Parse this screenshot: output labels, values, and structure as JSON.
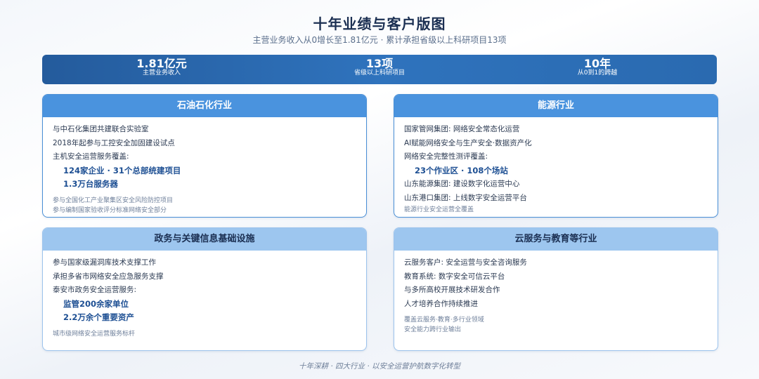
{
  "header": {
    "title": "十年业绩与客户版图",
    "subtitle": "主营业务收入从0增长至1.81亿元 · 累计承担省级以上科研项目13项"
  },
  "kpis": [
    {
      "value": "1.81亿元",
      "label": "主营业务收入"
    },
    {
      "value": "13项",
      "label": "省级以上科研项目"
    },
    {
      "value": "10年",
      "label": "从0到1的跨越"
    }
  ],
  "cards": {
    "petro": {
      "title": "石油石化行业",
      "lines": [
        "与中石化集团共建联合实验室",
        "2018年起参与工控安全加固建设试点",
        "主机安全运营服务覆盖:"
      ],
      "highlights": [
        "124家企业 · 31个总部统建项目",
        "1.3万台服务器"
      ],
      "notes": [
        "参与全国化工产业聚集区安全风险防控项目",
        "参与编制国家验收评分标准网络安全部分"
      ]
    },
    "energy": {
      "title": "能源行业",
      "lines": [
        "国家管网集团: 网络安全常态化运营",
        "AI赋能网络安全与生产安全·数据资产化",
        "网络安全完整性测评覆盖:"
      ],
      "highlights": [
        "23个作业区 · 108个场站"
      ],
      "lines2": [
        "山东能源集团: 建设数字化运营中心",
        "山东港口集团: 上线数字安全运营平台"
      ],
      "notes": [
        "能源行业安全运营全覆盖"
      ]
    },
    "gov": {
      "title": "政务与关键信息基础设施",
      "lines": [
        "参与国家级漏洞库技术支撑工作",
        "承担多省市网络安全应急服务支撑",
        "泰安市政务安全运营服务:"
      ],
      "highlights": [
        "监管200余家单位",
        "2.2万余个重要资产"
      ],
      "notes": [
        "城市级网络安全运营服务标杆"
      ]
    },
    "cloud": {
      "title": "云服务与教育等行业",
      "lines": [
        "云服务客户: 安全运营与安全咨询服务",
        "教育系统: 数字安全可信云平台",
        "与多所高校开展技术研发合作",
        "人才培养合作持续推进"
      ],
      "notes": [
        "覆盖云服务·教育·多行业领域",
        "安全能力跨行业输出"
      ]
    }
  },
  "footer": "十年深耕 · 四大行业 · 以安全运营护航数字化转型"
}
